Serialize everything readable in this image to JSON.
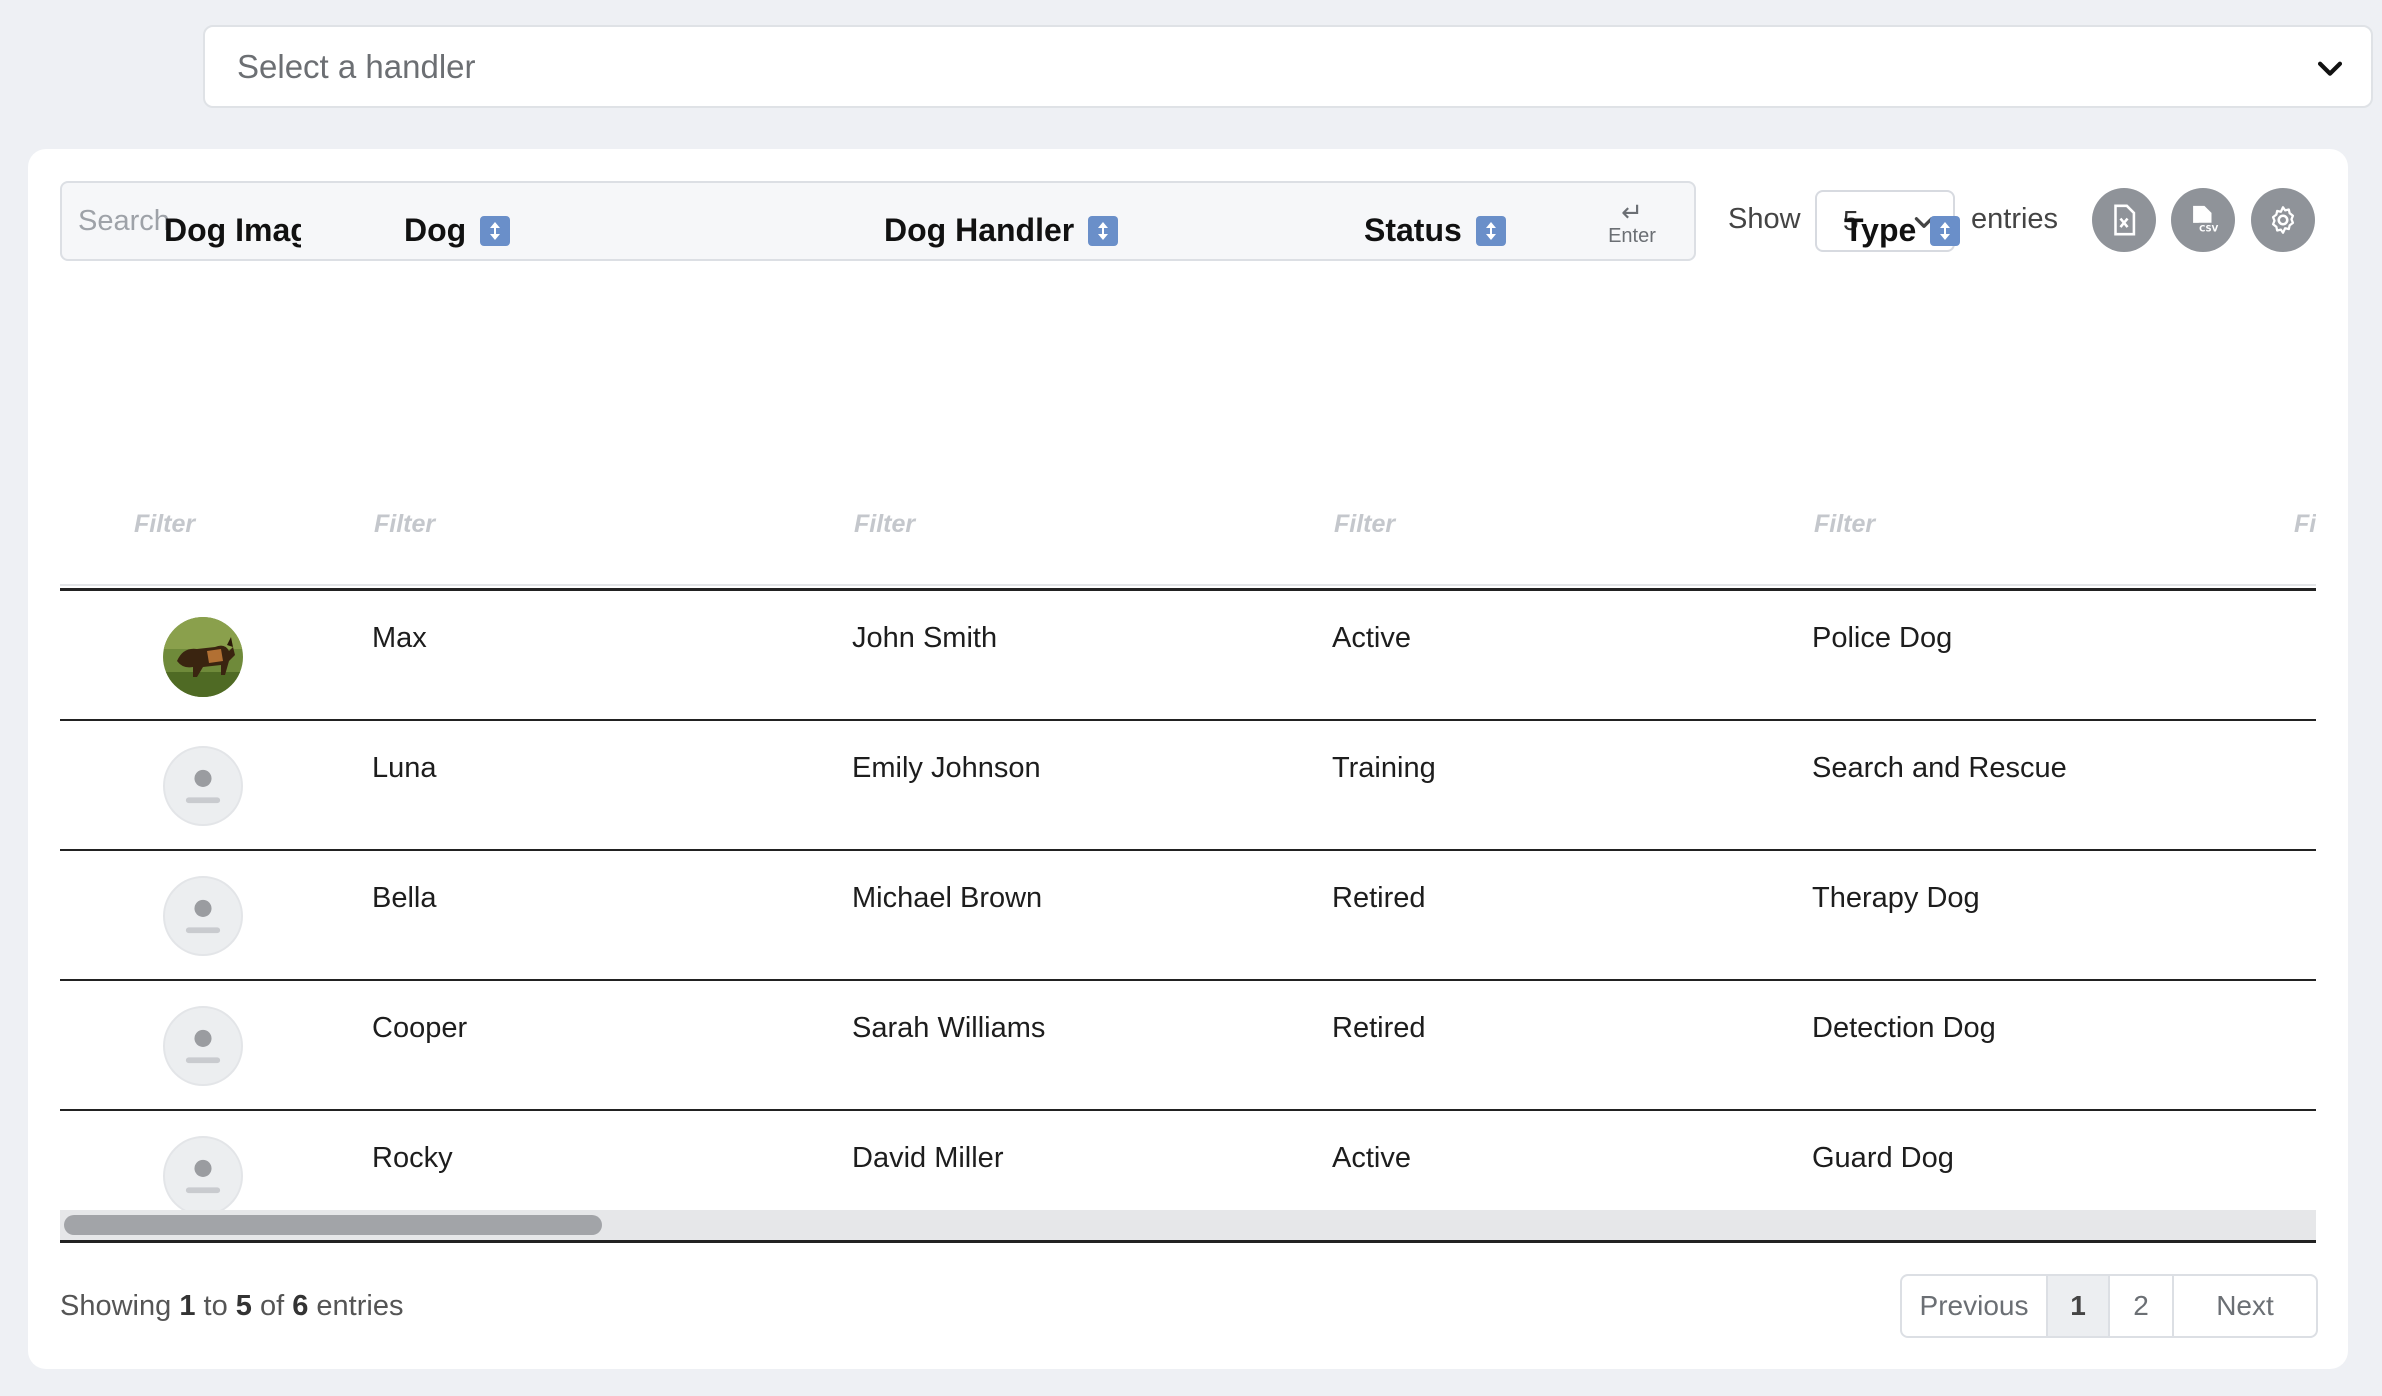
{
  "handler_select": {
    "placeholder": "Select a handler"
  },
  "toolbar": {
    "search_placeholder": "Search",
    "enter_hint": "Enter",
    "show_label": "Show",
    "entries_value": "5",
    "entries_label": "entries"
  },
  "columns": [
    {
      "label": "Dog Imag",
      "sortable": false
    },
    {
      "label": "Dog",
      "sortable": true
    },
    {
      "label": "Dog Handler",
      "sortable": true
    },
    {
      "label": "Status",
      "sortable": true
    },
    {
      "label": "Type",
      "sortable": true
    }
  ],
  "filter_placeholder": "Filter",
  "filter_partial": "Fi",
  "rows": [
    {
      "dog": "Max",
      "handler": "John Smith",
      "status": "Active",
      "type": "Police Dog",
      "has_photo": true
    },
    {
      "dog": "Luna",
      "handler": "Emily Johnson",
      "status": "Training",
      "type": "Search and Rescue",
      "has_photo": false
    },
    {
      "dog": "Bella",
      "handler": "Michael Brown",
      "status": "Retired",
      "type": "Therapy Dog",
      "has_photo": false
    },
    {
      "dog": "Cooper",
      "handler": "Sarah Williams",
      "status": "Retired",
      "type": "Detection Dog",
      "has_photo": false
    },
    {
      "dog": "Rocky",
      "handler": "David Miller",
      "status": "Active",
      "type": "Guard Dog",
      "has_photo": false
    }
  ],
  "footer": {
    "showing_prefix": "Showing",
    "from": "1",
    "to_word": "to",
    "to": "5",
    "of_word": "of",
    "total": "6",
    "suffix": "entries"
  },
  "pagination": {
    "previous": "Previous",
    "page1": "1",
    "page2": "2",
    "next": "Next"
  },
  "icons": [
    "chevron-down-icon",
    "enter-icon",
    "excel-export-icon",
    "csv-export-icon",
    "gear-icon",
    "sort-icon",
    "avatar-placeholder-icon"
  ],
  "colors": {
    "sort_icon": "#6a8fc9",
    "round_button": "#8f9399",
    "page_bg": "#eef0f4"
  }
}
